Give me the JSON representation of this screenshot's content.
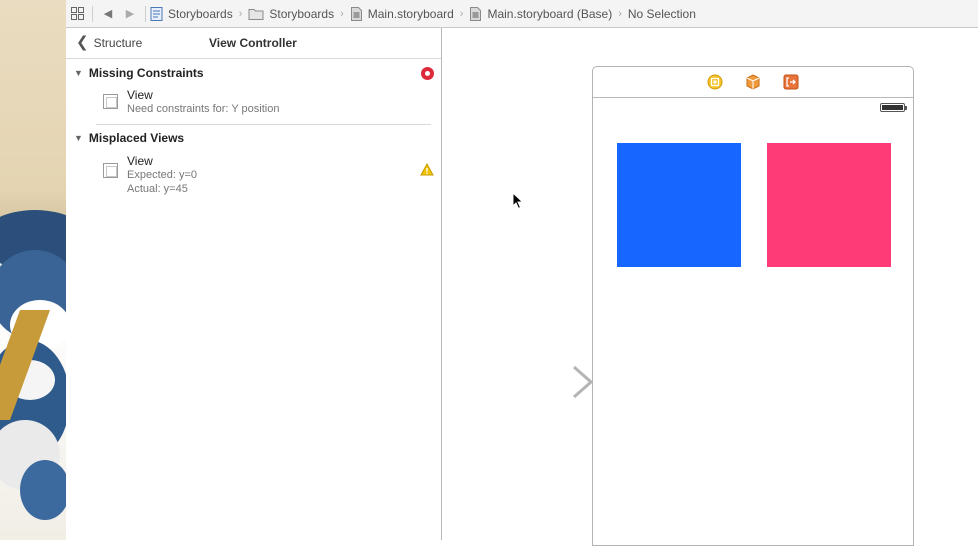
{
  "jumpbar": {
    "crumbs": [
      {
        "label": "Storyboards",
        "icon": "project-file-icon"
      },
      {
        "label": "Storyboards",
        "icon": "folder-icon"
      },
      {
        "label": "Main.storyboard",
        "icon": "storyboard-file-icon"
      },
      {
        "label": "Main.storyboard (Base)",
        "icon": "storyboard-file-icon"
      },
      {
        "label": "No Selection",
        "icon": ""
      }
    ]
  },
  "issues": {
    "back_label": "Structure",
    "title": "View Controller",
    "sections": [
      {
        "title": "Missing Constraints",
        "badge": "error",
        "items": [
          {
            "name": "View",
            "details": [
              "Need constraints for: Y position"
            ]
          }
        ]
      },
      {
        "title": "Misplaced Views",
        "badge": "warning",
        "items": [
          {
            "name": "View",
            "details": [
              "Expected: y=0",
              "Actual: y=45"
            ]
          }
        ]
      }
    ]
  },
  "canvas": {
    "views": [
      {
        "name": "blue-view",
        "color": "#1766ff"
      },
      {
        "name": "pink-view",
        "color": "#ff3b77"
      }
    ],
    "dock_icons": [
      "view-controller-icon",
      "first-responder-icon",
      "exit-icon"
    ]
  },
  "colors": {
    "error": "#dc2a3b",
    "warning": "#f2c200",
    "blue_view": "#1766ff",
    "pink_view": "#ff3b77"
  }
}
